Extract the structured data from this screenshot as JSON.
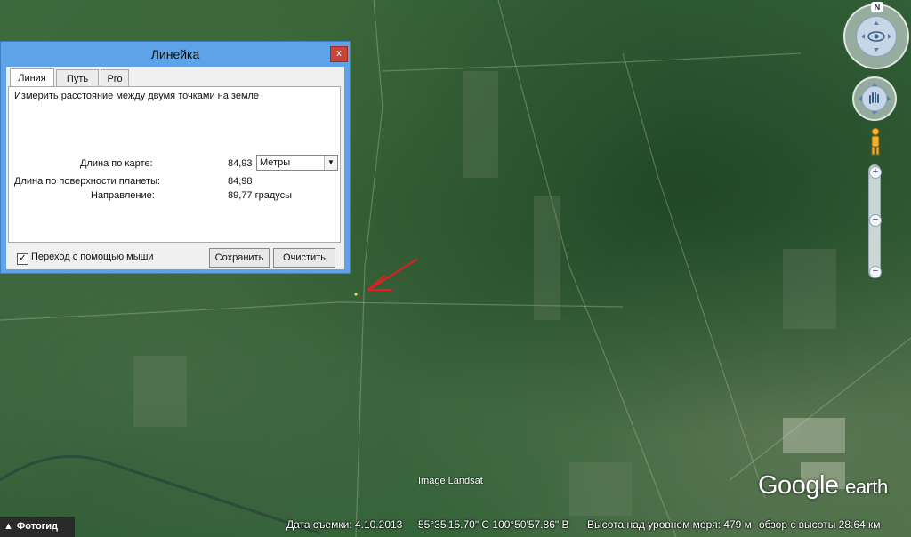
{
  "dialog": {
    "title": "Линейка",
    "close_label": "x",
    "tabs": [
      {
        "label": "Линия",
        "active": true
      },
      {
        "label": "Путь",
        "active": false
      },
      {
        "label": "Pro",
        "active": false
      }
    ],
    "description": "Измерить расстояние между двумя точками на земле",
    "map_length_label": "Длина по карте:",
    "map_length_value": "84,93",
    "units_selected": "Метры",
    "surface_length_label": "Длина по поверхности планеты:",
    "surface_length_value": "84,98",
    "heading_label": "Направление:",
    "heading_value": "89,77 градусы",
    "mouse_nav_label": "Переход с помощью мыши",
    "mouse_nav_checked": true,
    "save_label": "Сохранить",
    "clear_label": "Очистить"
  },
  "nav": {
    "north_label": "N",
    "zoom_in": "+",
    "zoom_out": "−",
    "zoom_level_fraction": 0.48
  },
  "map": {
    "imagery_credit": "Image Landsat",
    "logo_google": "Google",
    "logo_earth": "earth"
  },
  "status_bar": {
    "tour_label": "Фотогид",
    "capture_date": "Дата съемки: 4.10.2013",
    "coordinates": "55°35'15.70\" С  100°50'57.86\" В",
    "elevation": "Высота над уровнем моря:   479 м",
    "eye_alt": "обзор с высоты  28.64 км"
  },
  "colors": {
    "dialog_frame": "#5ea3e8",
    "close_button": "#c9453a",
    "annotation_arrow": "#e02020"
  }
}
